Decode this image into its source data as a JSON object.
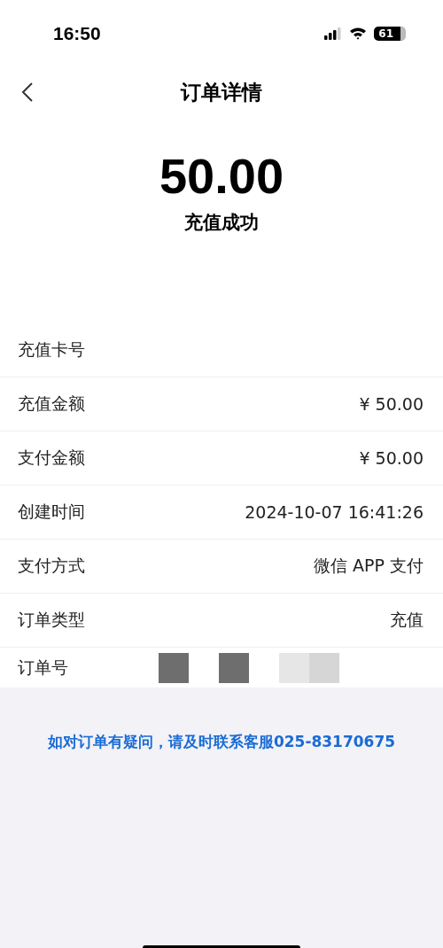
{
  "status_bar": {
    "time": "16:50",
    "battery": "61"
  },
  "nav": {
    "title": "订单详情"
  },
  "summary": {
    "amount": "50.00",
    "status": "充值成功"
  },
  "rows": [
    {
      "label": "充值卡号"
    },
    {
      "label": "充值金额",
      "value": "¥ 50.00"
    },
    {
      "label": "支付金额",
      "value": "¥ 50.00"
    },
    {
      "label": "创建时间",
      "value": "2024-10-07 16:41:26"
    },
    {
      "label": "支付方式",
      "value": "微信 APP 支付"
    },
    {
      "label": "订单类型",
      "value": "充值"
    },
    {
      "label": "订单号",
      "kind": "redacted"
    }
  ],
  "footer": {
    "notice": "如对订单有疑问，请及时联系客服025-83170675"
  }
}
